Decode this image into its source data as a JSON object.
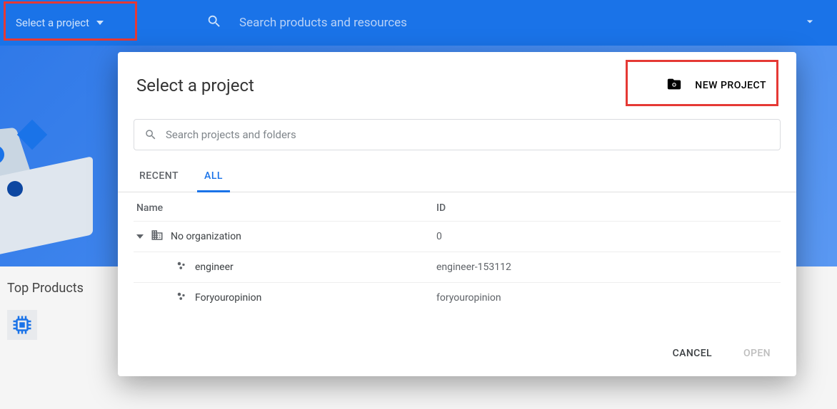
{
  "topbar": {
    "project_selector_label": "Select a project",
    "search_placeholder": "Search products and resources"
  },
  "sidebar": {
    "top_products_label": "Top Products"
  },
  "modal": {
    "title": "Select a project",
    "new_project_label": "NEW PROJECT",
    "search_placeholder": "Search projects and folders",
    "tabs": [
      {
        "label": "RECENT",
        "active": false
      },
      {
        "label": "ALL",
        "active": true
      }
    ],
    "columns": {
      "name": "Name",
      "id": "ID"
    },
    "rows": [
      {
        "type": "org",
        "name": "No organization",
        "id": "0",
        "indent": 0,
        "expandable": true
      },
      {
        "type": "project",
        "name": "engineer",
        "id": "engineer-153112",
        "indent": 1,
        "expandable": false
      },
      {
        "type": "project",
        "name": "Foryouropinion",
        "id": "foryouropinion",
        "indent": 1,
        "expandable": false
      }
    ],
    "footer": {
      "cancel": "CANCEL",
      "open": "OPEN"
    }
  }
}
